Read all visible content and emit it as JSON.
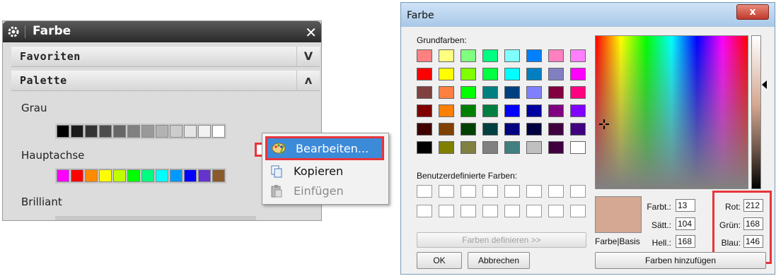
{
  "left_panel": {
    "title": "Farbe",
    "sections": {
      "favoriten": "Favoriten",
      "palette": "Palette"
    },
    "chevrons": {
      "down": "V",
      "up": "ʌ"
    },
    "groups": {
      "grau": "Grau",
      "hauptachse": "Hauptachse",
      "brilliant": "Brilliant"
    },
    "grau_colors": [
      "#000000",
      "#1a1a1a",
      "#333333",
      "#4d4d4d",
      "#666666",
      "#808080",
      "#999999",
      "#b3b3b3",
      "#cccccc",
      "#e6e6e6",
      "#f2f2f2",
      "#ffffff"
    ],
    "hauptachse_colors": [
      "#ff00ff",
      "#ff0000",
      "#ff8c00",
      "#ffff00",
      "#c0ff00",
      "#00ff00",
      "#00ff80",
      "#00ffff",
      "#0099ff",
      "#0000ff",
      "#6633cc",
      "#8b5a2b"
    ],
    "context_menu": {
      "bearbeiten": "Bearbeiten...",
      "kopieren": "Kopieren",
      "einfuegen": "Einfügen"
    }
  },
  "dialog": {
    "title": "Farbe",
    "close_label": "x",
    "grundfarben_label": "Grundfarben:",
    "basic_colors": [
      "#ff8080",
      "#ffff80",
      "#80ff80",
      "#00ff80",
      "#80ffff",
      "#0080ff",
      "#ff80c0",
      "#ff80ff",
      "#ff0000",
      "#ffff00",
      "#80ff00",
      "#00ff40",
      "#00ffff",
      "#0080c0",
      "#8080c0",
      "#ff00ff",
      "#804040",
      "#ff8040",
      "#00ff00",
      "#008080",
      "#004080",
      "#8080ff",
      "#800040",
      "#ff0080",
      "#800000",
      "#ff8000",
      "#008000",
      "#008040",
      "#0000ff",
      "#0000a0",
      "#800080",
      "#8000ff",
      "#400000",
      "#804000",
      "#004000",
      "#004040",
      "#000080",
      "#000040",
      "#400040",
      "#400080",
      "#000000",
      "#808000",
      "#808040",
      "#808080",
      "#408080",
      "#c0c0c0",
      "#400040",
      "#ffffff"
    ],
    "custom_label": "Benutzerdefinierte Farben:",
    "define_button": "Farben definieren >>",
    "ok_button": "OK",
    "cancel_button": "Abbrechen",
    "add_button": "Farben hinzufügen",
    "preview_label": "Farbe|Basis",
    "preview_color": "#d4a892",
    "hsl": {
      "farbt_label": "Farbt.:",
      "farbt": "13",
      "saett_label": "Sätt.:",
      "saett": "104",
      "hell_label": "Hell.:",
      "hell": "168"
    },
    "rgb": {
      "rot_label": "Rot:",
      "rot": "212",
      "gruen_label": "Grün:",
      "gruen": "168",
      "blau_label": "Blau:",
      "blau": "146"
    }
  },
  "colors": {
    "highlight_red": "#e8343a",
    "menu_selection": "#3c8bd8"
  }
}
